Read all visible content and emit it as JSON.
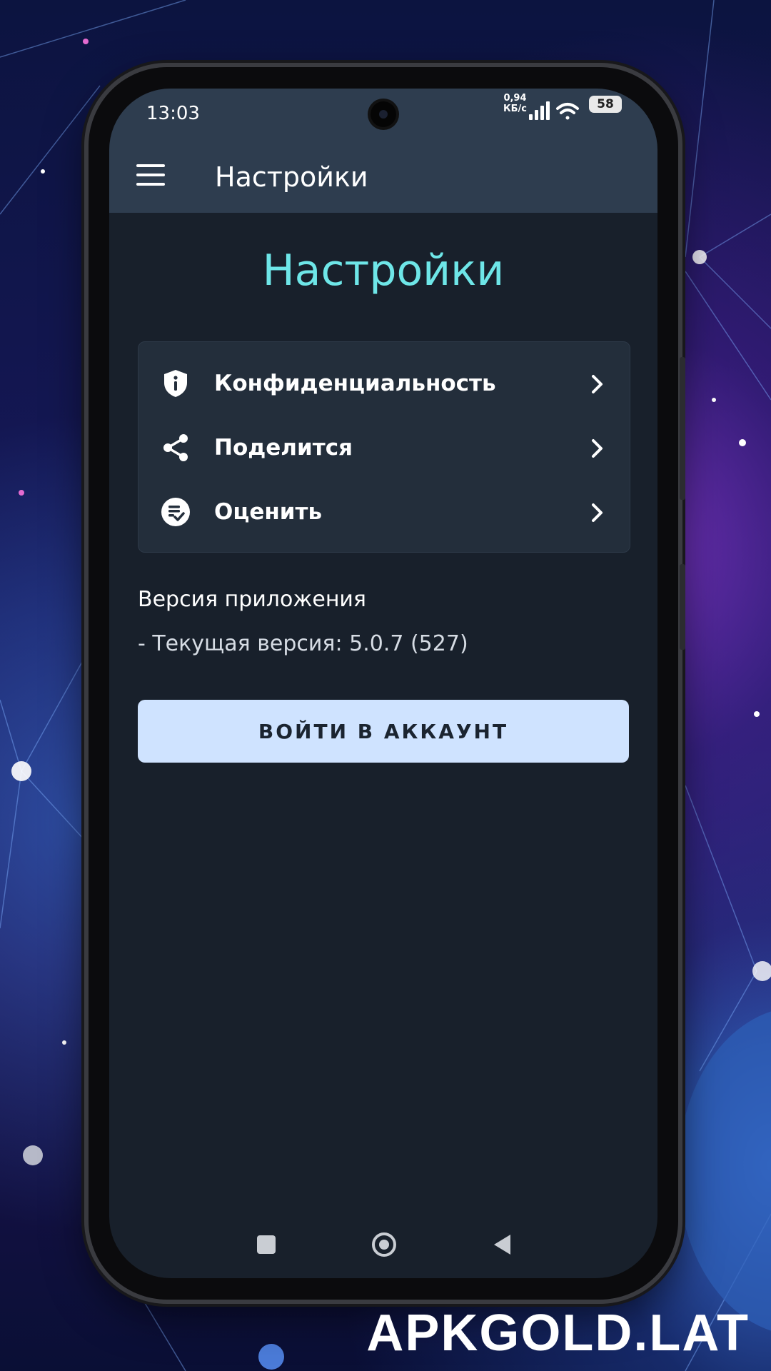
{
  "status_bar": {
    "time": "13:03",
    "net_speed_value": "0,94",
    "net_speed_unit": "КБ/с",
    "battery": "58",
    "signal_icon": "cell-signal-icon",
    "wifi_icon": "wifi-icon"
  },
  "app_bar": {
    "menu_icon": "hamburger-menu-icon",
    "title": "Настройки"
  },
  "page": {
    "heading": "Настройки",
    "heading_color": "#6ee6e8"
  },
  "settings_items": [
    {
      "label": "Конфиденциальность",
      "icon": "shield-info-icon"
    },
    {
      "label": "Поделится",
      "icon": "share-icon"
    },
    {
      "label": "Оценить",
      "icon": "rate-icon"
    }
  ],
  "version": {
    "title": "Версия приложения",
    "current": "- Текущая версия: 5.0.7 (527)"
  },
  "login_button": {
    "label": "ВОЙТИ В АККАУНТ",
    "color": "#cfe3ff"
  },
  "navigation": {
    "recents_icon": "square-recents-icon",
    "home_icon": "circle-home-icon",
    "back_icon": "triangle-back-icon"
  },
  "watermark": "APKGOLD.LAT"
}
